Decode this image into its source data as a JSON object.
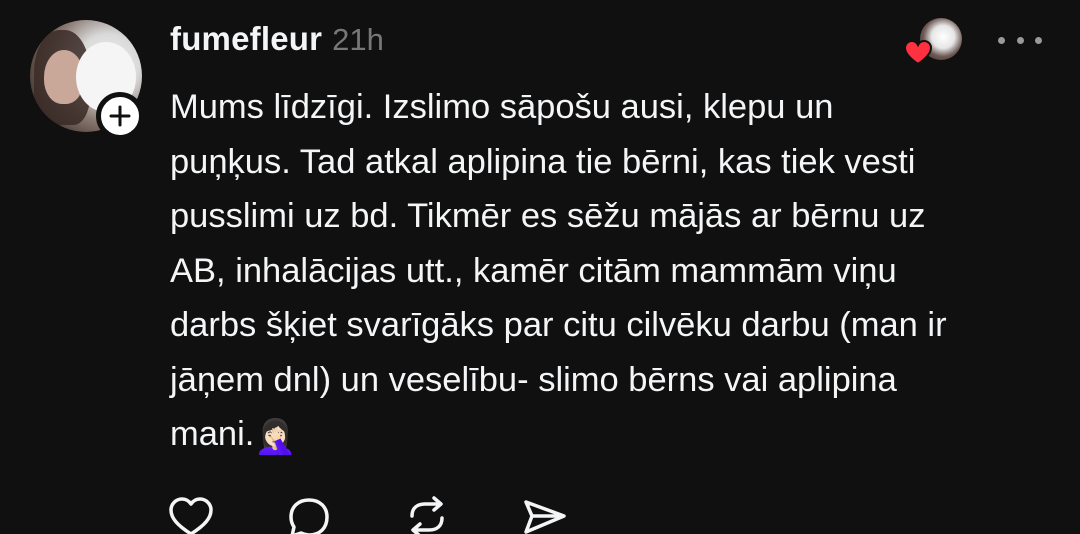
{
  "post": {
    "username": "fumefleur",
    "timestamp": "21h",
    "body_lines": [
      "Mums līdzīgi. Izslimo sāpošu ausi, klepu un",
      "puņķus. Tad atkal aplipina tie bērni, kas tiek vesti",
      "pusslimi uz bd. Tikmēr es sēžu mājās ar bērnu uz",
      "AB, inhalācijas utt., kamēr citām mammām viņu",
      "darbs šķiet svarīgāks par citu cilvēku darbu (man ir",
      "jāņem dnl) un veselību- slimo bērns vai aplipina",
      "mani."
    ],
    "trailing_emoji": "🤦🏻‍♀️"
  },
  "icons": {
    "follow": "plus-icon",
    "liked_by": "heart-icon",
    "more": "more-options-icon",
    "like": "heart-outline-icon",
    "reply": "comment-icon",
    "repost": "repost-icon",
    "share": "send-icon"
  },
  "colors": {
    "background": "#101010",
    "text": "#f3f5f7",
    "secondary_text": "#777777",
    "like_red": "#ff3040"
  }
}
